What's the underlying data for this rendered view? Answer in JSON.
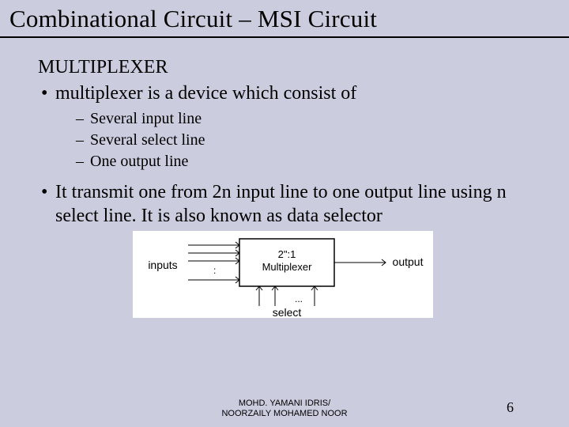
{
  "title": "Combinational Circuit – MSI Circuit",
  "heading": "MULTIPLEXER",
  "bullet1": "multiplexer is a device which consist of",
  "dashes": {
    "d1": "Several input line",
    "d2": "Several select line",
    "d3": "One output line"
  },
  "bullet2": "It transmit one from 2n input line to one output line using n select line. It is also known as data selector",
  "diagram": {
    "inputs_label": "inputs",
    "box_top": "2\":1",
    "box_bottom": "Multiplexer",
    "output_label": "output",
    "select_label": "select"
  },
  "footer_line1": "MOHD. YAMANI IDRIS/",
  "footer_line2": "NOORZAILY MOHAMED NOOR",
  "page_number": "6"
}
